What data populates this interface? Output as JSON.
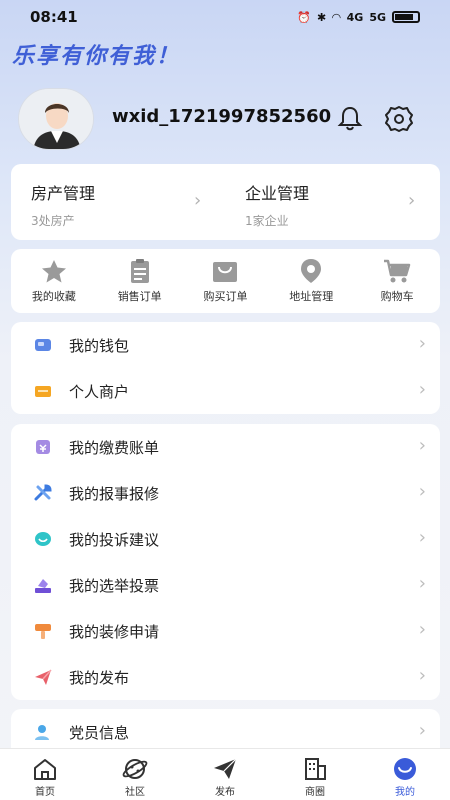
{
  "status_bar": {
    "time": "08:41",
    "network": "4G",
    "network2": "5G"
  },
  "slogan": "乐享有你有我！",
  "profile": {
    "username": "wxid_1721997852560"
  },
  "estate": [
    {
      "title": "房产管理",
      "sub": "3处房产"
    },
    {
      "title": "企业管理",
      "sub": "1家企业"
    }
  ],
  "shortcuts": [
    {
      "label": "我的收藏",
      "icon": "star-icon"
    },
    {
      "label": "销售订单",
      "icon": "clipboard-icon"
    },
    {
      "label": "购买订单",
      "icon": "shopping-bag-icon"
    },
    {
      "label": "地址管理",
      "icon": "location-pin-icon"
    },
    {
      "label": "购物车",
      "icon": "cart-icon"
    }
  ],
  "wallet_menu": [
    {
      "label": "我的钱包",
      "icon": "wallet-icon",
      "color": "#5b86e5"
    },
    {
      "label": "个人商户",
      "icon": "merchant-icon",
      "color": "#f5a623"
    }
  ],
  "service_menu": [
    {
      "label": "我的缴费账单",
      "icon": "bill-icon",
      "color": "#8e6bd9"
    },
    {
      "label": "我的报事报修",
      "icon": "repair-icon",
      "color": "#3d7be0"
    },
    {
      "label": "我的投诉建议",
      "icon": "complaint-icon",
      "color": "#2fc4c8"
    },
    {
      "label": "我的选举投票",
      "icon": "vote-icon",
      "color": "#6f4fd6"
    },
    {
      "label": "我的装修申请",
      "icon": "decoration-icon",
      "color": "#f08a3c"
    },
    {
      "label": "我的发布",
      "icon": "publish-icon",
      "color": "#e8606a"
    }
  ],
  "party_menu": [
    {
      "label": "党员信息",
      "icon": "member-icon",
      "color": "#4aa7e8"
    }
  ],
  "tabbar": [
    {
      "label": "首页",
      "icon": "home-icon"
    },
    {
      "label": "社区",
      "icon": "community-icon"
    },
    {
      "label": "发布",
      "icon": "send-icon"
    },
    {
      "label": "商圈",
      "icon": "building-icon"
    },
    {
      "label": "我的",
      "icon": "mine-icon",
      "active": true
    }
  ],
  "accent_color": "#3a5bd9"
}
